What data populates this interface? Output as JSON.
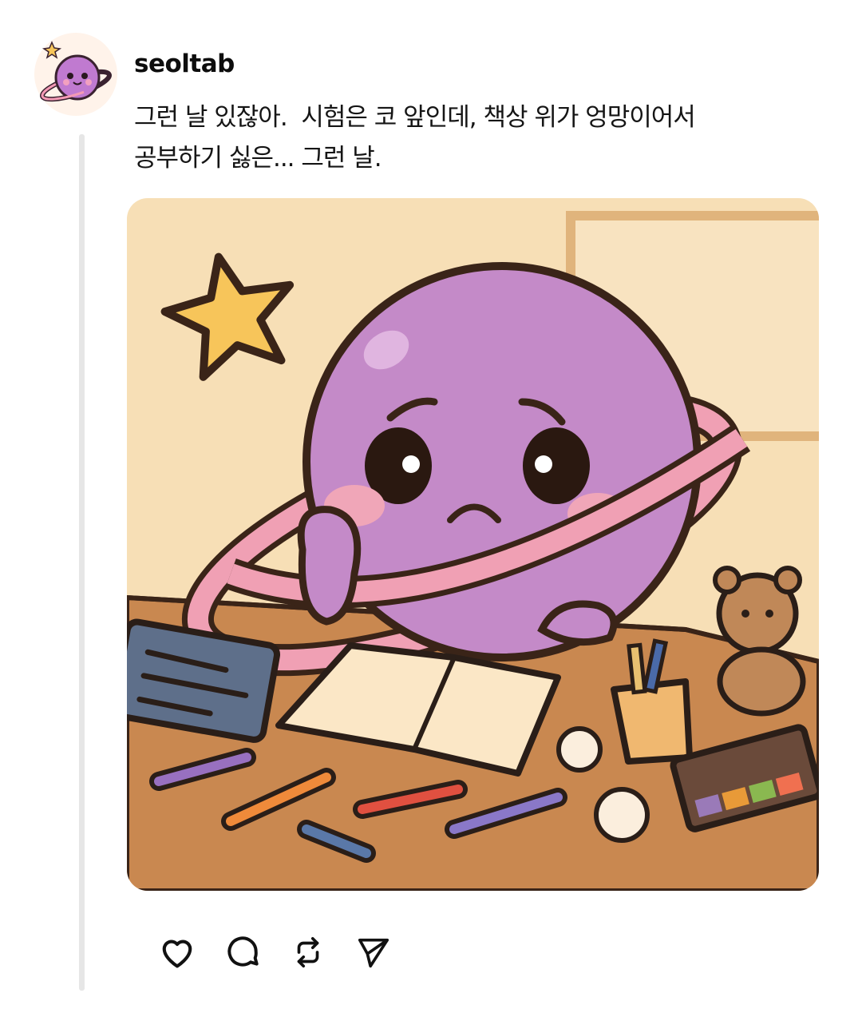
{
  "post": {
    "username": "seoltab",
    "text_lines": [
      "그런 날 있잖아.  시험은 코 앞인데, 책상 위가 엉망이어서",
      "공부하기 싫은... 그런 날."
    ],
    "image_description_icon": "sad-planet-at-messy-desk-illustration"
  },
  "actions": [
    {
      "name": "like",
      "icon": "heart-icon"
    },
    {
      "name": "comment",
      "icon": "comment-bubble-icon"
    },
    {
      "name": "repost",
      "icon": "repost-icon"
    },
    {
      "name": "share",
      "icon": "send-icon"
    }
  ],
  "colors": {
    "thread_line": "#e6e6e6",
    "planet_purple": "#c48ac8",
    "ring_pink": "#f0a0b4",
    "star_yellow": "#f7c55a",
    "desk": "#c98a52",
    "wall": "#f6dcb2"
  }
}
